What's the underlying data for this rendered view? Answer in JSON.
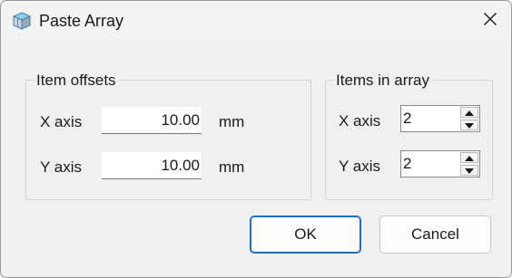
{
  "window": {
    "title": "Paste Array",
    "app_icon": "box-3d-icon",
    "close_icon": "close-icon"
  },
  "item_offsets": {
    "legend": "Item offsets",
    "x_label": "X axis",
    "x_value": "10.00",
    "x_unit": "mm",
    "y_label": "Y axis",
    "y_value": "10.00",
    "y_unit": "mm"
  },
  "items_in_array": {
    "legend": "Items in array",
    "x_label": "X axis",
    "x_value": "2",
    "y_label": "Y axis",
    "y_value": "2",
    "up_icon": "spin-up-icon",
    "down_icon": "spin-down-icon"
  },
  "buttons": {
    "ok_label": "OK",
    "cancel_label": "Cancel"
  },
  "colors": {
    "accent": "#1a6ec4",
    "background": "#f0f0f0"
  }
}
